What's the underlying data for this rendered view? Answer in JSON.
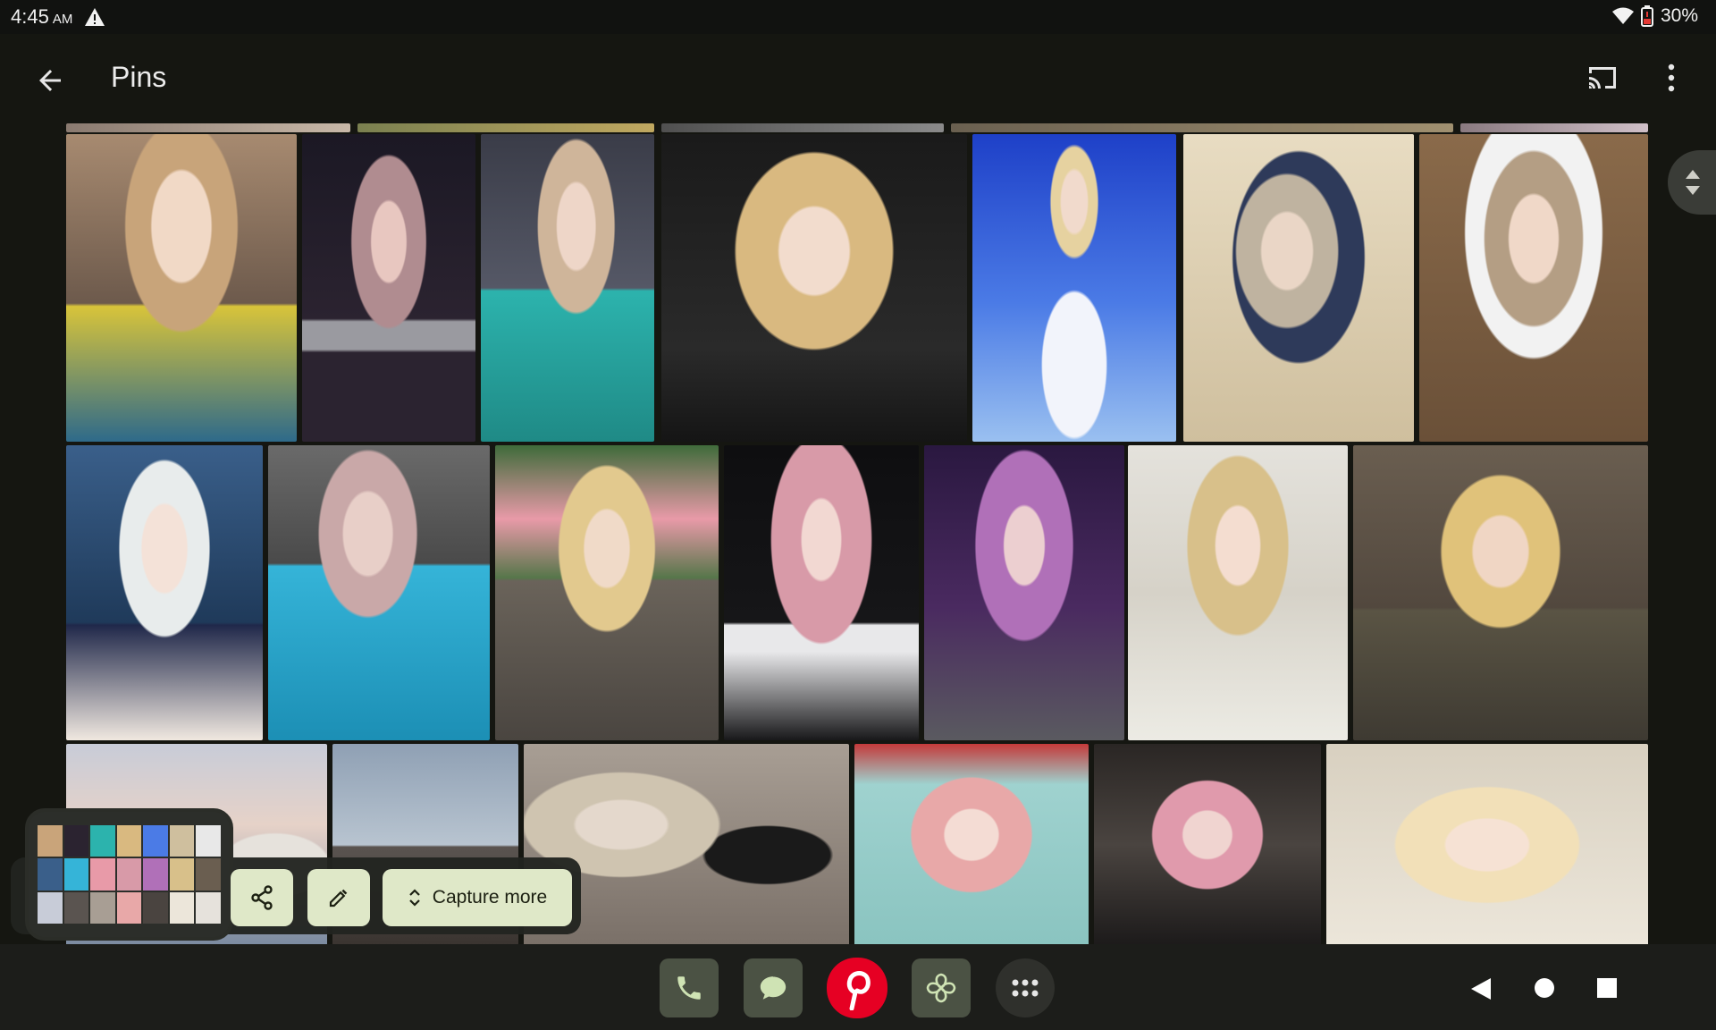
{
  "status_bar": {
    "time": "4:45",
    "ampm": "AM",
    "battery": "30%",
    "icons": [
      "warning-icon",
      "wifi-icon",
      "battery-icon"
    ]
  },
  "app_bar": {
    "title": "Pins",
    "icons": [
      "back-arrow-icon",
      "cast-icon",
      "more-vert-icon"
    ]
  },
  "pins": {
    "tile_count": 24,
    "subject": "photos of a blonde/pink-haired person"
  },
  "screenshot_toolbar": {
    "capture_more_label": "Capture more",
    "icons": [
      "share-icon",
      "edit-pencil-icon",
      "expand-icon"
    ]
  },
  "dock": {
    "apps": [
      "phone-icon",
      "messages-icon",
      "pinterest-icon",
      "pinwheel-icon",
      "app-drawer-icon"
    ]
  },
  "colors": {
    "background": "#151611",
    "accent_button": "#dfe8c8",
    "pinterest_red": "#e60023"
  }
}
